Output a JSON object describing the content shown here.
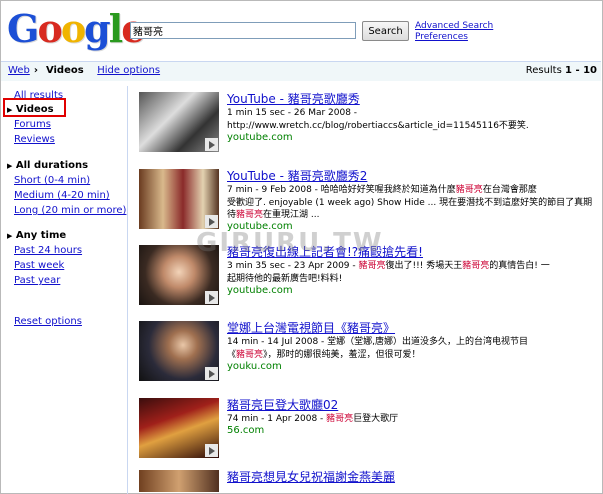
{
  "header": {
    "logo_text": "Google",
    "search_value": "豬哥亮",
    "search_button": "Search",
    "advanced_search": "Advanced Search",
    "preferences": "Preferences"
  },
  "bar": {
    "web": "Web",
    "videos": "Videos",
    "hide_options": "Hide options",
    "results_prefix": "Results ",
    "results_range": "1 - 10"
  },
  "sidebar": {
    "all_results": "All results",
    "videos": "Videos",
    "forums": "Forums",
    "reviews": "Reviews",
    "all_durations": "All durations",
    "short": "Short (0-4 min)",
    "medium": "Medium (4-20 min)",
    "long": "Long (20 min or more)",
    "any_time": "Any time",
    "past_24": "Past 24 hours",
    "past_week": "Past week",
    "past_year": "Past year",
    "reset": "Reset options"
  },
  "watermark": "GIRURU.TW",
  "results": [
    {
      "title": "YouTube - 豬哥亮歌廳秀",
      "meta": "1 min 15 sec - 26 Mar 2008 -",
      "snippet": "http://www.wretch.cc/blog/robertiaccs&article_id=11545116不要笑.",
      "url": "youtube.com"
    },
    {
      "title": "YouTube - 豬哥亮歌廳秀2",
      "meta": "7 min - 9 Feb 2008 - 哈哈哈好好笑喔我終於知道為什麼豬哥亮在台灣會那麼",
      "snippet": "受歡迎了. enjoyable (1 week ago) Show Hide ... 現在要潛找不到這麼好笑的節目了真期待豬哥亮在重現江湖 ...",
      "url": "youtube.com"
    },
    {
      "title": "豬哥亮復出線上記者會!?痛毆搶先看!",
      "meta": "3 min 35 sec - 23 Apr 2009 - 豬哥亮復出了!!! 秀場天王豬哥亮的真情告白! 一",
      "snippet": "起期待他的最新廣告吧!料料!",
      "url": "youtube.com"
    },
    {
      "title": "堂娜上台灣電視節目《豬哥亮》",
      "meta": "14 min - 14 Jul 2008 - 堂娜（堂娜,唐娜）出道没多久，上的台湾电视节目",
      "snippet": "《豬哥亮》，那时的娜很纯美，羞涩，但很可爱！",
      "url": "youku.com"
    },
    {
      "title": "豬哥亮巨登大歌廳02",
      "meta": "74 min - 1 Apr 2008 - 豬哥亮巨登大歌厅",
      "snippet": "",
      "url": "56.com"
    },
    {
      "title": "豬哥亮想見女兒祝福謝金燕美麗",
      "meta": "",
      "snippet": "",
      "url": ""
    }
  ]
}
